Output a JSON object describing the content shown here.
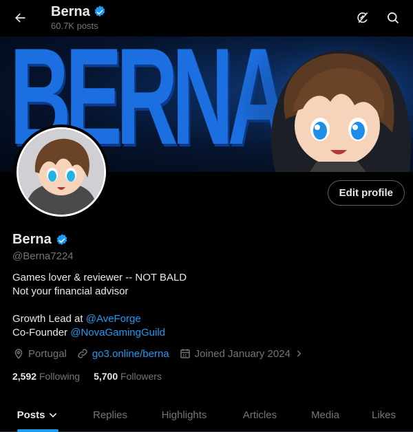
{
  "header": {
    "name": "Berna",
    "posts_count": "60.7K posts"
  },
  "banner": {
    "text": "BERNA"
  },
  "profile": {
    "edit_label": "Edit profile",
    "name": "Berna",
    "handle": "@Berna7224",
    "bio_lines": [
      "Games lover & reviewer -- NOT BALD",
      "Not your financial advisor"
    ],
    "growth_prefix": "Growth Lead at ",
    "growth_link": "@AveForge",
    "cofounder_prefix": "Co-Founder ",
    "cofounder_link": "@NovaGamingGuild"
  },
  "meta": {
    "location": "Portugal",
    "website": "go3.online/berna",
    "joined": "Joined January 2024"
  },
  "stats": {
    "following_count": "2,592",
    "following_label": "Following",
    "followers_count": "5,700",
    "followers_label": "Followers"
  },
  "tabs": [
    {
      "label": "Posts"
    },
    {
      "label": "Replies"
    },
    {
      "label": "Highlights"
    },
    {
      "label": "Articles"
    },
    {
      "label": "Media"
    },
    {
      "label": "Likes"
    }
  ],
  "colors": {
    "accent": "#1d9bf0",
    "background": "#000000",
    "text": "#e7e9ea",
    "muted": "#71767b",
    "verified": "#1d9bf0"
  },
  "icons": {
    "back": "arrow-left-icon",
    "verified": "verified-badge-icon",
    "grok": "grok-icon",
    "search": "search-icon",
    "location": "location-pin-icon",
    "link": "link-icon",
    "calendar": "calendar-icon",
    "chevron": "chevron-right-icon",
    "dropdown": "chevron-down-icon"
  }
}
